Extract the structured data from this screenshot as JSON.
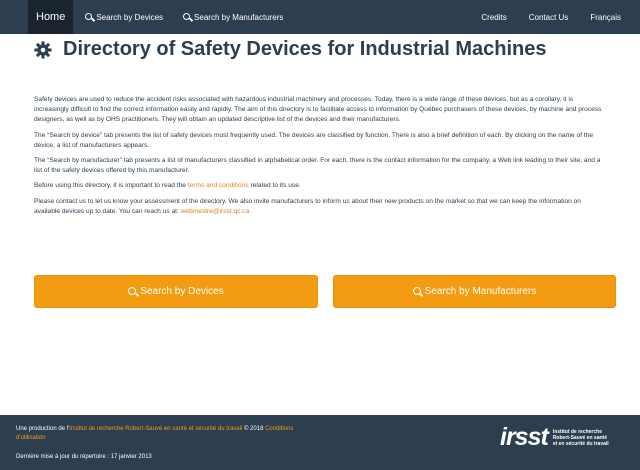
{
  "nav": {
    "home": "Home",
    "search_devices": "Search by Devices",
    "search_manufacturers": "Search by Manufacturers",
    "credits": "Credits",
    "contact": "Contact Us",
    "language": "Français"
  },
  "page": {
    "title": "Directory of Safety Devices for Industrial Machines",
    "title_icon": "gear-icon"
  },
  "content": {
    "p1": "Safety devices are used to reduce the accident risks associated with hazardous industrial machinery and processes. Today, there is a wide range of these devices, but as a corollary, it is increasingly difficult to find the correct information easily and rapidly. The aim of this directory is to facilitate access to information by Québec purchasers of these devices, by machine and process designers, as well as by OHS practitioners. They will obtain an updated descriptive list of the devices and their manufacturers.",
    "p2": "The “Search by device” tab presents the list of safety devices most frequently used. The devices are classified by function. There is also a brief definition of each. By clicking on the name of the device, a list of manufacturers appears.",
    "p3": "The “Search by manufacturer” tab presents a list of manufacturers classified in alphabetical order. For each, there is the contact information for the company, a Web link leading to their site, and a list of the safety devices offered by this manufacturer.",
    "p4_before": "Before using this directory, it is important to read the ",
    "p4_link": "terms and conditions",
    "p4_after": " related to its use.",
    "p5": "Please contact us to let us know your assessment of the directory. We also invite manufacturers to inform us about their new products on the market so that we can keep the information on available devices up to date. You can reach us at: ",
    "p5_email": "webmestre@irsst.qc.ca"
  },
  "buttons": {
    "devices": "Search by Devices",
    "manufacturers": "Search by Manufacturers"
  },
  "footer": {
    "production_prefix": "Une production de l'",
    "institute_link": "Institut de recherche Robert-Sauvé en santé et sécurité du travail",
    "copyright": " © 2018 ",
    "conditions_link": "Conditions d'utilisation",
    "last_update": "Dernière mise à jour du répertoire : 17 janvier 2013",
    "logo_word": "irsst",
    "logo_line1": "Institut de recherche",
    "logo_line2": "Robert-Sauvé en santé",
    "logo_line3": "et en sécurité du travail"
  },
  "colors": {
    "navbar": "#2c3e50",
    "accent": "#f39c12",
    "link": "#e67e22"
  }
}
